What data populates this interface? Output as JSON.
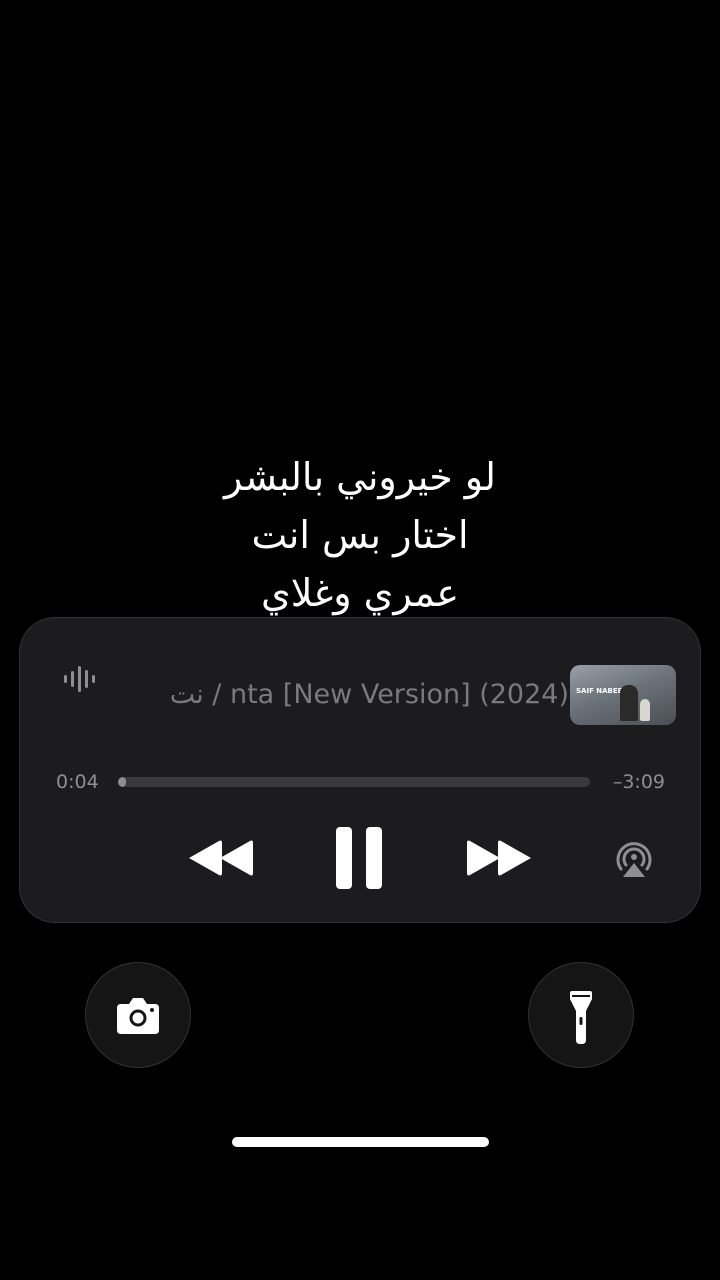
{
  "lyrics": {
    "line1": "لو خيروني بالبشر",
    "line2": "اختار بس انت",
    "line3": "عمري وغلاي"
  },
  "now_playing": {
    "title_visible": "نت / nta [New Version] (2024)",
    "artwork_label": "SAIF NABEEL",
    "elapsed": "0:04",
    "remaining": "–3:09",
    "progress_fraction": 0.01
  },
  "icons": {
    "waveform": "waveform-icon",
    "rewind": "rewind-icon",
    "pause": "pause-icon",
    "forward": "fast-forward-icon",
    "airplay": "airplay-audio-icon",
    "camera": "camera-icon",
    "flashlight": "flashlight-icon"
  },
  "colors": {
    "background": "#000000",
    "panel": "#1c1c1e",
    "secondary_text": "#8e8e93",
    "primary": "#ffffff"
  }
}
